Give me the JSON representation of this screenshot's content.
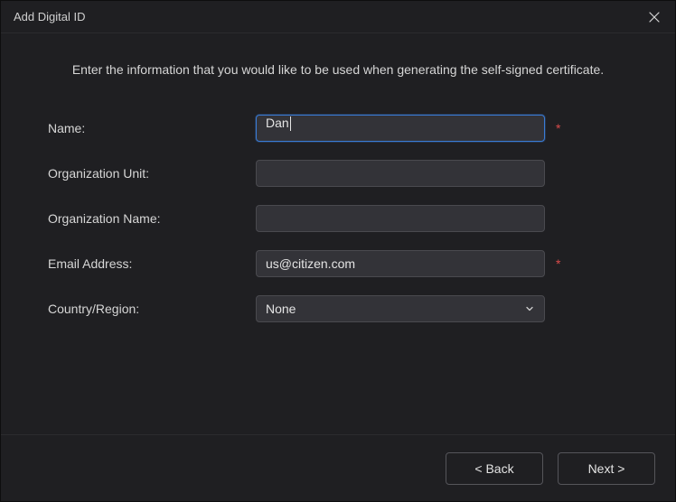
{
  "window": {
    "title": "Add Digital ID"
  },
  "instructions": "Enter the information that you would like to be used when generating the self-signed certificate.",
  "form": {
    "name": {
      "label": "Name:",
      "value": "Dan",
      "required": true
    },
    "org_unit": {
      "label": "Organization Unit:",
      "value": "",
      "required": false
    },
    "org_name": {
      "label": "Organization Name:",
      "value": "",
      "required": false
    },
    "email": {
      "label": "Email Address:",
      "value": "us@citizen.com",
      "required": true
    },
    "country": {
      "label": "Country/Region:",
      "value": "None",
      "required": false
    }
  },
  "required_marker": "*",
  "buttons": {
    "back": "< Back",
    "next": "Next >"
  }
}
